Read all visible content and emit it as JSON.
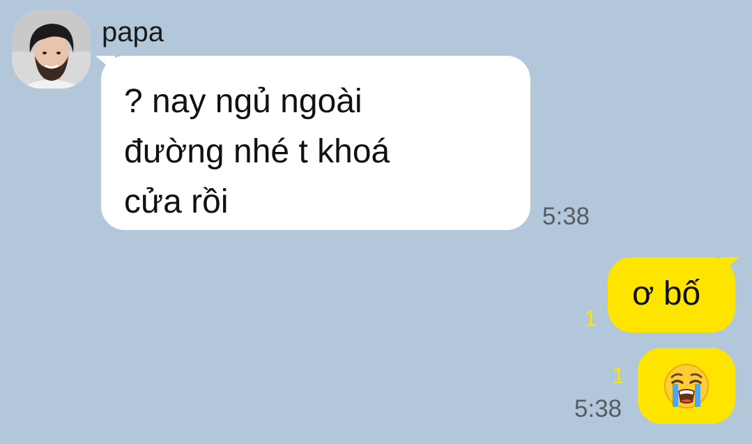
{
  "contact": {
    "name": "papa",
    "avatar": "profile-photo"
  },
  "messages": {
    "incoming": {
      "text": "? nay ngủ ngoài\nđường nhé t khoá\ncửa rồi",
      "time": "5:38"
    },
    "outgoing": [
      {
        "text": "ơ bố",
        "unread": "1"
      },
      {
        "emoji": "loudly-crying-face",
        "unread": "1",
        "time": "5:38"
      }
    ]
  },
  "colors": {
    "background": "#b2c7da",
    "incoming_bubble": "#ffffff",
    "outgoing_bubble": "#fee500",
    "unread": "#f6e30f",
    "time": "#555d63"
  }
}
